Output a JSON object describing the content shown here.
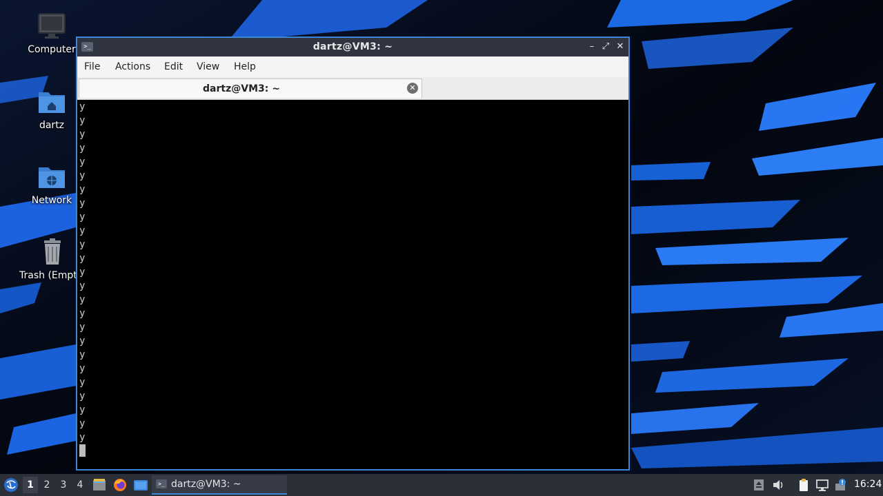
{
  "desktop": {
    "icons": [
      {
        "label": "Computer",
        "icon": "monitor-icon"
      },
      {
        "label": "dartz",
        "icon": "home-folder-icon"
      },
      {
        "label": "Network",
        "icon": "network-folder-icon"
      },
      {
        "label": "Trash (Empty)",
        "icon": "trash-icon"
      }
    ]
  },
  "window": {
    "title": "dartz@VM3: ~",
    "buttons": {
      "minimize": "–",
      "maximize": "⤢",
      "close": "✕"
    },
    "menu": [
      "File",
      "Actions",
      "Edit",
      "View",
      "Help"
    ],
    "tab": {
      "title": "dartz@VM3: ~",
      "close_glyph": "✕"
    },
    "terminal": {
      "lines": [
        "y",
        "y",
        "y",
        "y",
        "y",
        "y",
        "y",
        "y",
        "y",
        "y",
        "y",
        "y",
        "y",
        "y",
        "y",
        "y",
        "y",
        "y",
        "y",
        "y",
        "y",
        "y",
        "y",
        "y",
        "y"
      ]
    }
  },
  "taskbar": {
    "workspaces": [
      "1",
      "2",
      "3",
      "4"
    ],
    "active_workspace": "1",
    "launchers": [
      "file-manager-icon",
      "firefox-icon",
      "desktop-icon"
    ],
    "task": {
      "label": "dartz@VM3: ~",
      "icon": "terminal-icon"
    },
    "tray": [
      "eject-icon",
      "volume-icon",
      "clipboard-icon",
      "network-icon",
      "update-notifier-icon"
    ],
    "clock": "16:24"
  },
  "colors": {
    "accent": "#3c88d8",
    "terminal_bg": "#000000",
    "titlebar": "#2f3440",
    "taskbar": "#2b2f38"
  }
}
